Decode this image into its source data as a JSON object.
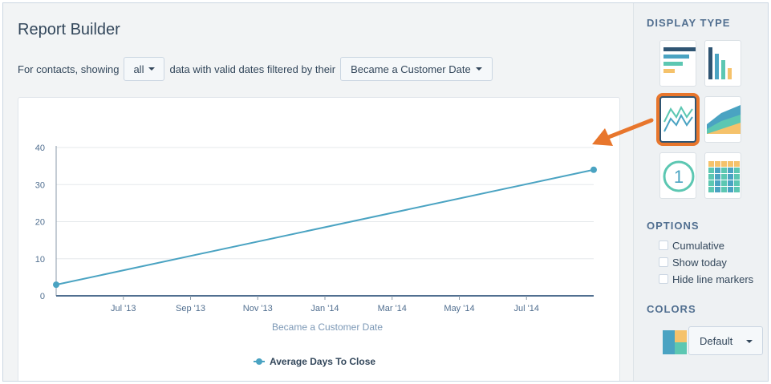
{
  "report": {
    "title": "Report Builder",
    "filter_prefix": "For contacts, showing",
    "filter_scope": "all",
    "filter_middle": "data with valid dates filtered by their",
    "filter_date_field": "Became a Customer Date"
  },
  "chart_data": {
    "type": "line",
    "xlabel": "Became a Customer Date",
    "ylabel": "",
    "x_ticks": [
      "Jul '13",
      "Sep '13",
      "Nov '13",
      "Jan '14",
      "Mar '14",
      "May '14",
      "Jul '14"
    ],
    "y_ticks": [
      0,
      10,
      20,
      30,
      40
    ],
    "ylim": [
      0,
      40
    ],
    "grid": true,
    "legend_position": "bottom",
    "series": [
      {
        "name": "Average Days To Close",
        "color": "#4aa3c2",
        "points": [
          {
            "x": "2013-05",
            "y": 3
          },
          {
            "x": "2014-09",
            "y": 34
          }
        ]
      }
    ]
  },
  "sidebar": {
    "display_type_heading": "DISPLAY TYPE",
    "display_types": [
      {
        "name": "horizontal-bar",
        "icon": "horizontal-bar-chart-icon",
        "selected": false
      },
      {
        "name": "vertical-bar",
        "icon": "vertical-bar-chart-icon",
        "selected": false
      },
      {
        "name": "line",
        "icon": "line-chart-icon",
        "selected": true
      },
      {
        "name": "area",
        "icon": "area-chart-icon",
        "selected": false
      },
      {
        "name": "single-number",
        "icon": "single-number-icon",
        "selected": false,
        "label": "1"
      },
      {
        "name": "table",
        "icon": "table-grid-icon",
        "selected": false
      }
    ],
    "options_heading": "OPTIONS",
    "options": [
      {
        "label": "Cumulative",
        "checked": false
      },
      {
        "label": "Show today",
        "checked": false
      },
      {
        "label": "Hide line markers",
        "checked": false
      }
    ],
    "colors_heading": "COLORS",
    "colors_value": "Default",
    "palette": [
      "#4aa3c2",
      "#f5c26b",
      "#5cc7b2",
      "#2f5573"
    ],
    "highlight_color": "#e8762c"
  }
}
